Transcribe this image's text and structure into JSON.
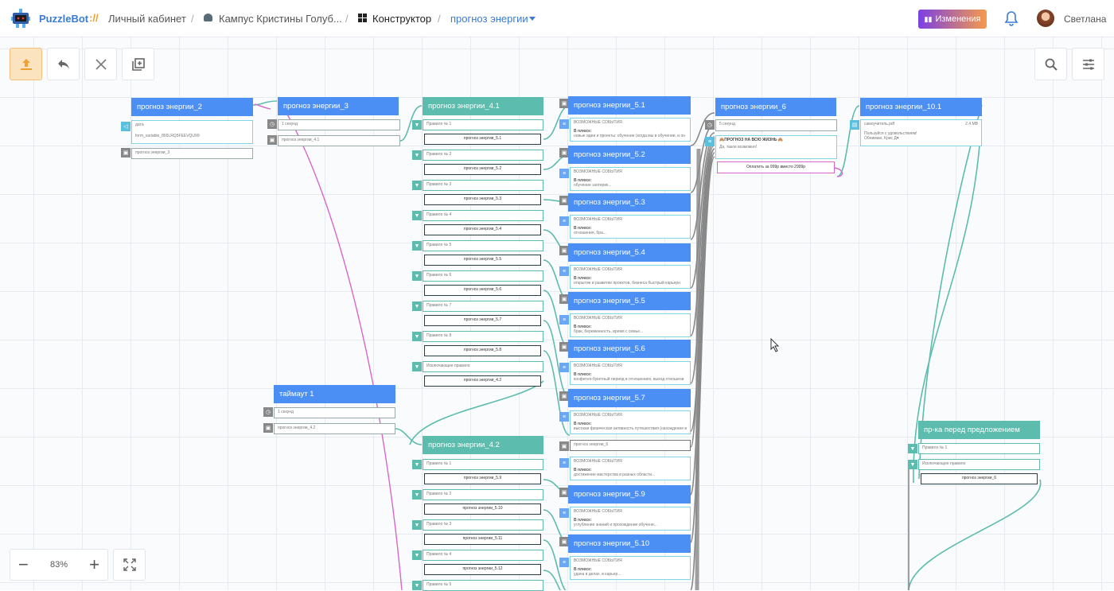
{
  "header": {
    "brand": "PuzzleBot",
    "brand_sep": "://",
    "crumbs": [
      "Личный кабинет",
      "Кампус Кристины Голуб...",
      "Конструктор",
      "прогноз энергии"
    ],
    "changes": "Изменения",
    "user": "Светлана"
  },
  "zoom": {
    "value": "83%"
  },
  "colors": {
    "blue": "#4b8ff5",
    "teal": "#5cbcad",
    "pink": "#d966cc"
  },
  "nodes": [
    {
      "title": "прогноз энергии_2",
      "color": "blue",
      "rows": [
        {
          "text": "дата",
          "sub": "form_variable_865LRQ5FEEVQU99",
          "icon": "cyan"
        },
        {
          "text": "прогноз энергии_3",
          "icon": "gray"
        }
      ]
    },
    {
      "title": "прогноз энергии_3",
      "color": "blue",
      "rows": [
        {
          "text": "1 секунд",
          "icon": "gray"
        },
        {
          "text": "прогноз энергии_4.1",
          "icon": "gray"
        }
      ]
    },
    {
      "title": "прогноз энергии_4.1",
      "color": "teal"
    },
    {
      "title": "прогноз энергии_5.1",
      "color": "blue"
    },
    {
      "title": "прогноз энергии_6",
      "color": "blue"
    },
    {
      "title": "прогноз энергии_10.1",
      "color": "blue"
    },
    {
      "title": "прогноз энергии_5.2",
      "color": "blue"
    },
    {
      "title": "прогноз энергии_5.3",
      "color": "blue"
    },
    {
      "title": "прогноз энергии_5.4",
      "color": "blue"
    },
    {
      "title": "прогноз энергии_5.5",
      "color": "blue"
    },
    {
      "title": "прогноз энергии_5.6",
      "color": "blue"
    },
    {
      "title": "прогноз энергии_5.7",
      "color": "blue"
    },
    {
      "title": "прогноз энергии_5.9",
      "color": "blue"
    },
    {
      "title": "прогноз энергии_5.10",
      "color": "blue"
    },
    {
      "title": "таймаут 1",
      "color": "blue"
    },
    {
      "title": "прогноз энергии_4.2",
      "color": "teal"
    },
    {
      "title": "пр-ка перед предложением",
      "color": "teal"
    }
  ],
  "rules41": [
    {
      "rule": "Правило № 1",
      "target": "прогноз энергии_5.1"
    },
    {
      "rule": "Правило № 2",
      "target": "прогноз энергии_5.2"
    },
    {
      "rule": "Правило № 3",
      "target": "прогноз энергии_5.3"
    },
    {
      "rule": "Правило № 4",
      "target": "прогноз энергии_5.4"
    },
    {
      "rule": "Правило № 5",
      "target": "прогноз энергии_5.5"
    },
    {
      "rule": "Правило № 6",
      "target": "прогноз энергии_5.6"
    },
    {
      "rule": "Правило № 7",
      "target": "прогноз энергии_5.7"
    },
    {
      "rule": "Правило № 8",
      "target": "прогноз энергии_5.8"
    },
    {
      "rule": "Исключающее правило",
      "target": "прогноз энергии_4.2"
    }
  ],
  "rules42": [
    {
      "rule": "Правило № 1",
      "target": "прогноз энергии_5.9"
    },
    {
      "rule": "Правило № 2",
      "target": "прогноз энергии_5.10"
    },
    {
      "rule": "Правило № 3",
      "target": "прогноз энергии_5.11"
    },
    {
      "rule": "Правило № 4",
      "target": "прогноз энергии_5.12"
    },
    {
      "rule": "Правило № 5",
      "target": ""
    }
  ],
  "msgs5": [
    {
      "head": "ВОЗМОЖНЫЕ СОБЫТИЯ",
      "plus": "В плюсе:",
      "line": "новые идеи и проекты: обучение (когда мы в обучении, и он"
    },
    {
      "head": "ВОЗМОЖНЫЕ СОБЫТИЯ",
      "plus": "В плюсе:",
      "line": "обучение эзотерик..."
    },
    {
      "head": "ВОЗМОЖНЫЕ СОБЫТИЯ",
      "plus": "В плюсе:",
      "line": "отношения, бра..."
    },
    {
      "head": "ВОЗМОЖНЫЕ СОБЫТИЯ",
      "plus": "В плюсе:",
      "line": "открытие и развитие проектов, бизнеса быстрый карьерн"
    },
    {
      "head": "ВОЗМОЖНЫЕ СОБЫТИЯ",
      "plus": "В плюсе:",
      "line": "брак, беременность, время с семье..."
    },
    {
      "head": "ВОЗМОЖНЫЕ СОБЫТИЯ",
      "plus": "В плюсе:",
      "line": "конфетно-букетный период в отношениях, выход отношени"
    },
    {
      "head": "ВОЗМОЖНЫЕ СОБЫТИЯ",
      "plus": "В плюсе:",
      "line": "высокая физическая активность путешествия (нахождение в"
    },
    {
      "head": "ВОЗМОЖНЫЕ СОБЫТИЯ",
      "plus": "В плюсе:",
      "line": "достижение мастерства в разных области..."
    },
    {
      "head": "ВОЗМОЖНЫЕ СОБЫТИЯ",
      "plus": "В плюсе:",
      "line": "углубление знаний и прохождение обучени..."
    },
    {
      "head": "ВОЗМОЖНЫЕ СОБЫТИЯ",
      "plus": "В плюсе:",
      "line": "удача в делах, в карьер..."
    }
  ],
  "n57_link": "прогноз энергии_6",
  "n6": {
    "delay": "5 секунд",
    "text1": "🙈ПРОГНОЗ НА ВСЮ ЖИЗНЬ 🙈",
    "text2": "Да, такое возможно!",
    "button": "Оплатить за 999р вместо 2999р"
  },
  "n101": {
    "file": "самоучитель.pdf",
    "size": "2.4 MB",
    "line1": "Пользуйся с удовольствием!",
    "line2": "Обнимаю, Крис Д♥"
  },
  "timeout": {
    "row1": "1 секунд",
    "row2": "прогноз энергии_4.2"
  },
  "check": {
    "row1": "Правило № 1",
    "row2": "Исключающее правило",
    "row3": "прогноз энергии_6"
  }
}
